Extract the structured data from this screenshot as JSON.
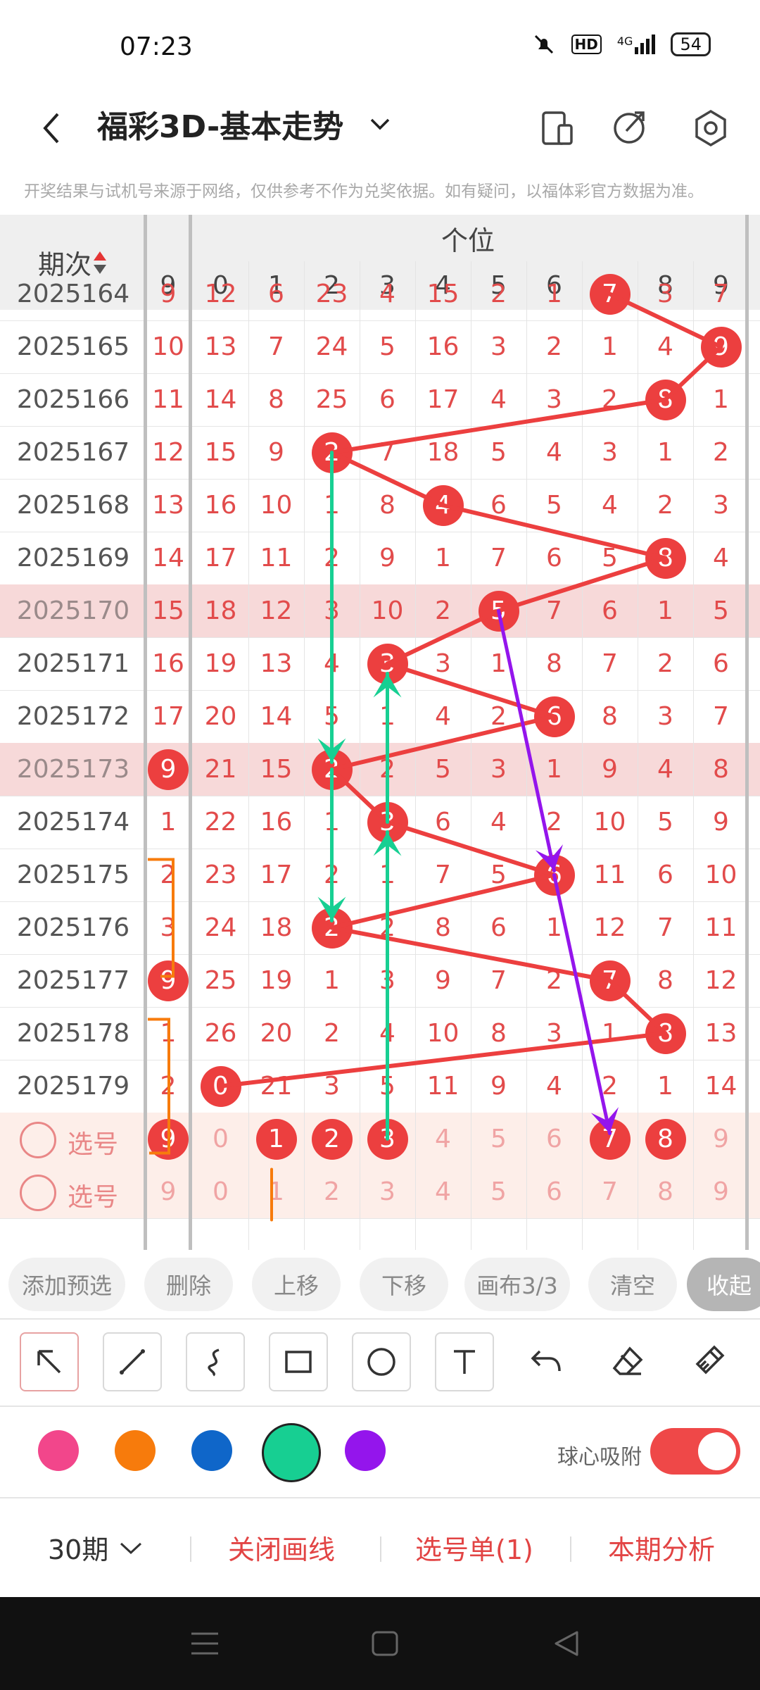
{
  "status_bar": {
    "time": "07:23",
    "network": "4G",
    "hd": "HD",
    "battery": "54"
  },
  "app_bar": {
    "title": "福彩3D-基本走势"
  },
  "notice": "开奖结果与试机号来源于网络，仅供参考不作为兑奖依据。如有疑问，以福体彩官方数据为准。",
  "table": {
    "period_header": "期次",
    "group_header": "个位",
    "prev_column_header": "9",
    "digit_headers": [
      "0",
      "1",
      "2",
      "3",
      "4",
      "5",
      "6",
      "7",
      "8",
      "9"
    ],
    "rows": [
      {
        "period": "2025164",
        "prev": "9",
        "cells": [
          "12",
          "6",
          "23",
          "4",
          "15",
          "2",
          "1",
          "7",
          "3",
          "7"
        ],
        "ball": 7
      },
      {
        "period": "2025165",
        "prev": "10",
        "cells": [
          "13",
          "7",
          "24",
          "5",
          "16",
          "3",
          "2",
          "1",
          "4",
          "9"
        ],
        "ball": 9
      },
      {
        "period": "2025166",
        "prev": "11",
        "cells": [
          "14",
          "8",
          "25",
          "6",
          "17",
          "4",
          "3",
          "2",
          "8",
          "1"
        ],
        "ball": 8
      },
      {
        "period": "2025167",
        "prev": "12",
        "cells": [
          "15",
          "9",
          "2",
          "7",
          "18",
          "5",
          "4",
          "3",
          "1",
          "2"
        ],
        "ball": 2
      },
      {
        "period": "2025168",
        "prev": "13",
        "cells": [
          "16",
          "10",
          "1",
          "8",
          "4",
          "6",
          "5",
          "4",
          "2",
          "3"
        ],
        "ball": 4
      },
      {
        "period": "2025169",
        "prev": "14",
        "cells": [
          "17",
          "11",
          "2",
          "9",
          "1",
          "7",
          "6",
          "5",
          "8",
          "4"
        ],
        "ball": 8
      },
      {
        "period": "2025170",
        "prev": "15",
        "cells": [
          "18",
          "12",
          "3",
          "10",
          "2",
          "5",
          "7",
          "6",
          "1",
          "5"
        ],
        "ball": 5,
        "highlight": true
      },
      {
        "period": "2025171",
        "prev": "16",
        "cells": [
          "19",
          "13",
          "4",
          "3",
          "3",
          "1",
          "8",
          "7",
          "2",
          "6"
        ],
        "ball": 3
      },
      {
        "period": "2025172",
        "prev": "17",
        "cells": [
          "20",
          "14",
          "5",
          "1",
          "4",
          "2",
          "6",
          "8",
          "3",
          "7"
        ],
        "ball": 6
      },
      {
        "period": "2025173",
        "prev": "9",
        "cells": [
          "21",
          "15",
          "2",
          "2",
          "5",
          "3",
          "1",
          "9",
          "4",
          "8"
        ],
        "ball": 2,
        "prev_ball": true,
        "highlight": true
      },
      {
        "period": "2025174",
        "prev": "1",
        "cells": [
          "22",
          "16",
          "1",
          "3",
          "6",
          "4",
          "2",
          "10",
          "5",
          "9"
        ],
        "ball": 3
      },
      {
        "period": "2025175",
        "prev": "2",
        "cells": [
          "23",
          "17",
          "2",
          "1",
          "7",
          "5",
          "6",
          "11",
          "6",
          "10"
        ],
        "ball": 6
      },
      {
        "period": "2025176",
        "prev": "3",
        "cells": [
          "24",
          "18",
          "2",
          "2",
          "8",
          "6",
          "1",
          "12",
          "7",
          "11"
        ],
        "ball": 2
      },
      {
        "period": "2025177",
        "prev": "9",
        "cells": [
          "25",
          "19",
          "1",
          "3",
          "9",
          "7",
          "2",
          "7",
          "8",
          "12"
        ],
        "ball": 7,
        "prev_ball": true
      },
      {
        "period": "2025178",
        "prev": "1",
        "cells": [
          "26",
          "20",
          "2",
          "4",
          "10",
          "8",
          "3",
          "1",
          "8",
          "13"
        ],
        "ball": 8
      },
      {
        "period": "2025179",
        "prev": "2",
        "cells": [
          "0",
          "21",
          "3",
          "5",
          "11",
          "9",
          "4",
          "2",
          "1",
          "14"
        ],
        "ball": 0
      }
    ],
    "select_rows": [
      {
        "label": "选号",
        "prev": "9",
        "prev_ball": true,
        "cells": [
          "0",
          "1",
          "2",
          "3",
          "4",
          "5",
          "6",
          "7",
          "8",
          "9"
        ],
        "balls": [
          1,
          2,
          3,
          7,
          8
        ]
      },
      {
        "label": "选号",
        "prev": "9",
        "prev_ball": false,
        "cells": [
          "0",
          "1",
          "2",
          "3",
          "4",
          "5",
          "6",
          "7",
          "8",
          "9"
        ],
        "balls": []
      }
    ]
  },
  "action_chips": [
    "添加预选",
    "删除",
    "上移",
    "下移",
    "画布3/3",
    "清空",
    "收起"
  ],
  "tools": [
    "arrow-tool",
    "line-tool",
    "curve-tool",
    "rectangle-tool",
    "circle-tool",
    "text-tool",
    "undo-tool",
    "eraser-tool",
    "clear-tool"
  ],
  "colors": {
    "swatches": [
      "#f2468b",
      "#f77b0c",
      "#0f66c9",
      "#17cf92",
      "#9415ec"
    ],
    "accent": "#ef4848",
    "ball": "#ec3f3f",
    "snap_label": "球心吸附"
  },
  "bottom_bar": {
    "periods": "30期",
    "close_drawing": "关闭画线",
    "selection_list": "选号单(1)",
    "analysis": "本期分析"
  }
}
